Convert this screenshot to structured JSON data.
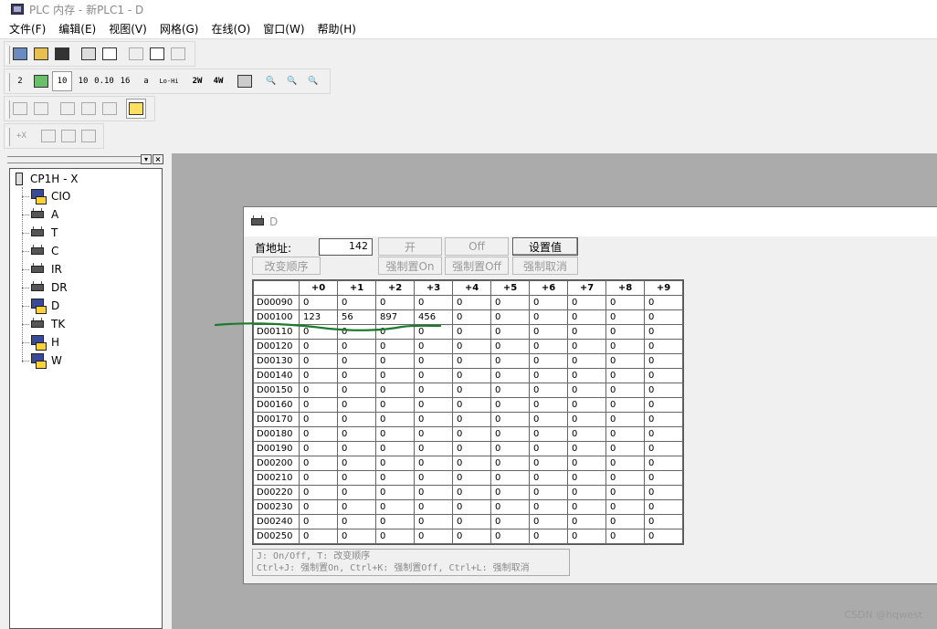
{
  "window": {
    "title": "PLC 内存 - 新PLC1 - D"
  },
  "menu": [
    {
      "label": "文件(F)"
    },
    {
      "label": "编辑(E)"
    },
    {
      "label": "视图(V)"
    },
    {
      "label": "网格(G)"
    },
    {
      "label": "在线(O)"
    },
    {
      "label": "窗口(W)"
    },
    {
      "label": "帮助(H)"
    }
  ],
  "toolbar": {
    "row2": [
      "2",
      "",
      "10",
      "10",
      "0.10",
      "16",
      "a",
      "Lo-Hi",
      "2W",
      "4W",
      "",
      "",
      "",
      ""
    ],
    "row4": [
      "+X"
    ]
  },
  "tree": {
    "root": "CP1H - X",
    "items": [
      {
        "label": "CIO",
        "icon": "monitor-icon"
      },
      {
        "label": "A",
        "icon": "chip-icon"
      },
      {
        "label": "T",
        "icon": "chip-icon"
      },
      {
        "label": "C",
        "icon": "chip-icon"
      },
      {
        "label": "IR",
        "icon": "chip-icon"
      },
      {
        "label": "DR",
        "icon": "chip-icon"
      },
      {
        "label": "D",
        "icon": "monitor-icon"
      },
      {
        "label": "TK",
        "icon": "chip-icon"
      },
      {
        "label": "H",
        "icon": "monitor-icon"
      },
      {
        "label": "W",
        "icon": "monitor-icon"
      }
    ]
  },
  "dwindow": {
    "title": "D",
    "address_label": "首地址:",
    "address_value": "142",
    "btn_on": "开",
    "btn_off": "Off",
    "btn_set_value": "设置值",
    "btn_change_order": "改变顺序",
    "btn_force_on": "强制置On",
    "btn_force_off": "强制置Off",
    "btn_force_cancel": "强制取消",
    "columns": [
      "+0",
      "+1",
      "+2",
      "+3",
      "+4",
      "+5",
      "+6",
      "+7",
      "+8",
      "+9"
    ],
    "rows": [
      {
        "addr": "D00090",
        "values": [
          "0",
          "0",
          "0",
          "0",
          "0",
          "0",
          "0",
          "0",
          "0",
          "0"
        ]
      },
      {
        "addr": "D00100",
        "values": [
          "123",
          "56",
          "897",
          "456",
          "0",
          "0",
          "0",
          "0",
          "0",
          "0"
        ]
      },
      {
        "addr": "D00110",
        "values": [
          "0",
          "0",
          "0",
          "0",
          "0",
          "0",
          "0",
          "0",
          "0",
          "0"
        ]
      },
      {
        "addr": "D00120",
        "values": [
          "0",
          "0",
          "0",
          "0",
          "0",
          "0",
          "0",
          "0",
          "0",
          "0"
        ]
      },
      {
        "addr": "D00130",
        "values": [
          "0",
          "0",
          "0",
          "0",
          "0",
          "0",
          "0",
          "0",
          "0",
          "0"
        ]
      },
      {
        "addr": "D00140",
        "values": [
          "0",
          "0",
          "0",
          "0",
          "0",
          "0",
          "0",
          "0",
          "0",
          "0"
        ]
      },
      {
        "addr": "D00150",
        "values": [
          "0",
          "0",
          "0",
          "0",
          "0",
          "0",
          "0",
          "0",
          "0",
          "0"
        ]
      },
      {
        "addr": "D00160",
        "values": [
          "0",
          "0",
          "0",
          "0",
          "0",
          "0",
          "0",
          "0",
          "0",
          "0"
        ]
      },
      {
        "addr": "D00170",
        "values": [
          "0",
          "0",
          "0",
          "0",
          "0",
          "0",
          "0",
          "0",
          "0",
          "0"
        ]
      },
      {
        "addr": "D00180",
        "values": [
          "0",
          "0",
          "0",
          "0",
          "0",
          "0",
          "0",
          "0",
          "0",
          "0"
        ]
      },
      {
        "addr": "D00190",
        "values": [
          "0",
          "0",
          "0",
          "0",
          "0",
          "0",
          "0",
          "0",
          "0",
          "0"
        ]
      },
      {
        "addr": "D00200",
        "values": [
          "0",
          "0",
          "0",
          "0",
          "0",
          "0",
          "0",
          "0",
          "0",
          "0"
        ]
      },
      {
        "addr": "D00210",
        "values": [
          "0",
          "0",
          "0",
          "0",
          "0",
          "0",
          "0",
          "0",
          "0",
          "0"
        ]
      },
      {
        "addr": "D00220",
        "values": [
          "0",
          "0",
          "0",
          "0",
          "0",
          "0",
          "0",
          "0",
          "0",
          "0"
        ]
      },
      {
        "addr": "D00230",
        "values": [
          "0",
          "0",
          "0",
          "0",
          "0",
          "0",
          "0",
          "0",
          "0",
          "0"
        ]
      },
      {
        "addr": "D00240",
        "values": [
          "0",
          "0",
          "0",
          "0",
          "0",
          "0",
          "0",
          "0",
          "0",
          "0"
        ]
      },
      {
        "addr": "D00250",
        "values": [
          "0",
          "0",
          "0",
          "0",
          "0",
          "0",
          "0",
          "0",
          "0",
          "0"
        ]
      }
    ],
    "hint_line1": "J: On/Off,    T: 改变顺序",
    "hint_line2": "Ctrl+J: 强制置On,  Ctrl+K:  强制置Off,  Ctrl+L: 强制取消"
  },
  "watermark": "CSDN @hqwest",
  "colors": {
    "mdi_background": "#ababab",
    "annotation_stroke": "#1e7a2e"
  }
}
